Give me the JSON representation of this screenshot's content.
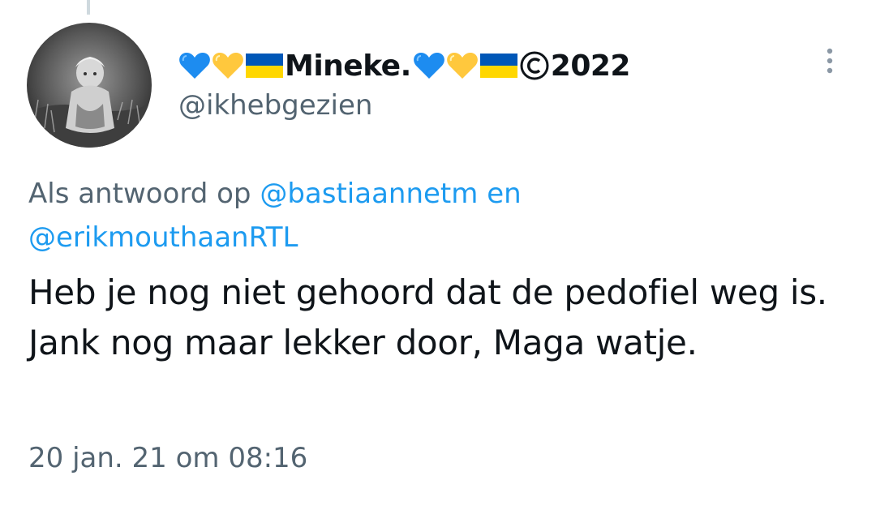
{
  "tweet": {
    "author": {
      "name_prefix_icons": [
        "blue-heart-icon",
        "yellow-heart-icon",
        "ukraine-flag-icon"
      ],
      "name_text": "Mineke.",
      "name_suffix_icons": [
        "blue-heart-icon",
        "yellow-heart-icon",
        "ukraine-flag-icon",
        "copyright-icon"
      ],
      "name_suffix_text": "2022",
      "handle": "@ikhebgezien"
    },
    "reply_context": {
      "prefix": "Als antwoord op",
      "mention_1": "@bastiaannetm",
      "connector": "en",
      "mention_2": "@erikmouthaanRTL"
    },
    "text": "Heb je nog niet gehoord dat de pedofiel weg is. Jank nog maar lekker door, Maga watje.",
    "timestamp": "20 jan. 21 om 08:16"
  },
  "colors": {
    "link": "#1d9bf0",
    "secondary_text": "#536471",
    "primary_text": "#0f1419",
    "heart_blue": "#1d8cf0",
    "heart_yellow": "#ffc83d",
    "flag_blue": "#0057b7",
    "flag_yellow": "#ffd700"
  }
}
